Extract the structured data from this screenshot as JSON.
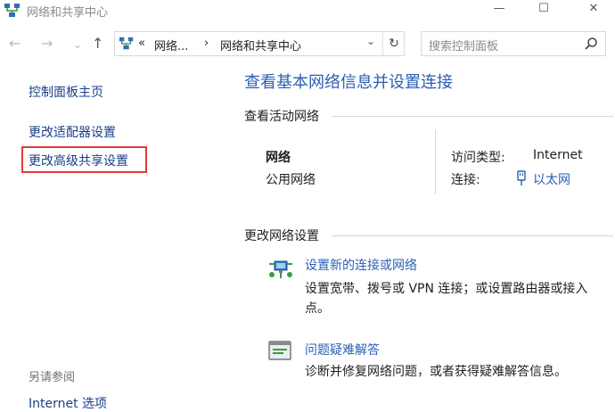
{
  "window": {
    "title": "网络和共享中心",
    "minimize": "—",
    "maximize": "☐",
    "close": "✕"
  },
  "nav": {
    "back": "←",
    "forward": "→",
    "recent": "⌄",
    "up": "↑",
    "address": {
      "overflow": "«",
      "seg1": "网络...",
      "sep": "›",
      "seg2": "网络和共享中心",
      "dropdown": "⌄",
      "refresh": "↻"
    },
    "search": {
      "placeholder": "搜索控制面板",
      "icon": "search-icon"
    }
  },
  "sidebar": {
    "home": "控制面板主页",
    "adapter": "更改适配器设置",
    "advanced": "更改高级共享设置",
    "highlight_color": "#e23b3b",
    "see_also": "另请参阅",
    "internet_options": "Internet 选项"
  },
  "main": {
    "title": "查看基本网络信息并设置连接",
    "active_networks": {
      "heading": "查看活动网络",
      "network_name": "网络",
      "network_type": "公用网络",
      "access_type_label": "访问类型:",
      "access_type_value": "Internet",
      "connection_label": "连接:",
      "connection_value": "以太网"
    },
    "change_settings": {
      "heading": "更改网络设置",
      "new_connection": {
        "link": "设置新的连接或网络",
        "desc": "设置宽带、拨号或 VPN 连接；或设置路由器或接入点。"
      },
      "troubleshoot": {
        "link": "问题疑难解答",
        "desc": "诊断并修复网络问题，或者获得疑难解答信息。"
      }
    }
  },
  "colors": {
    "link": "#2a5fb5",
    "nav_link": "#1a3f8a",
    "highlight": "#e23b3b"
  }
}
